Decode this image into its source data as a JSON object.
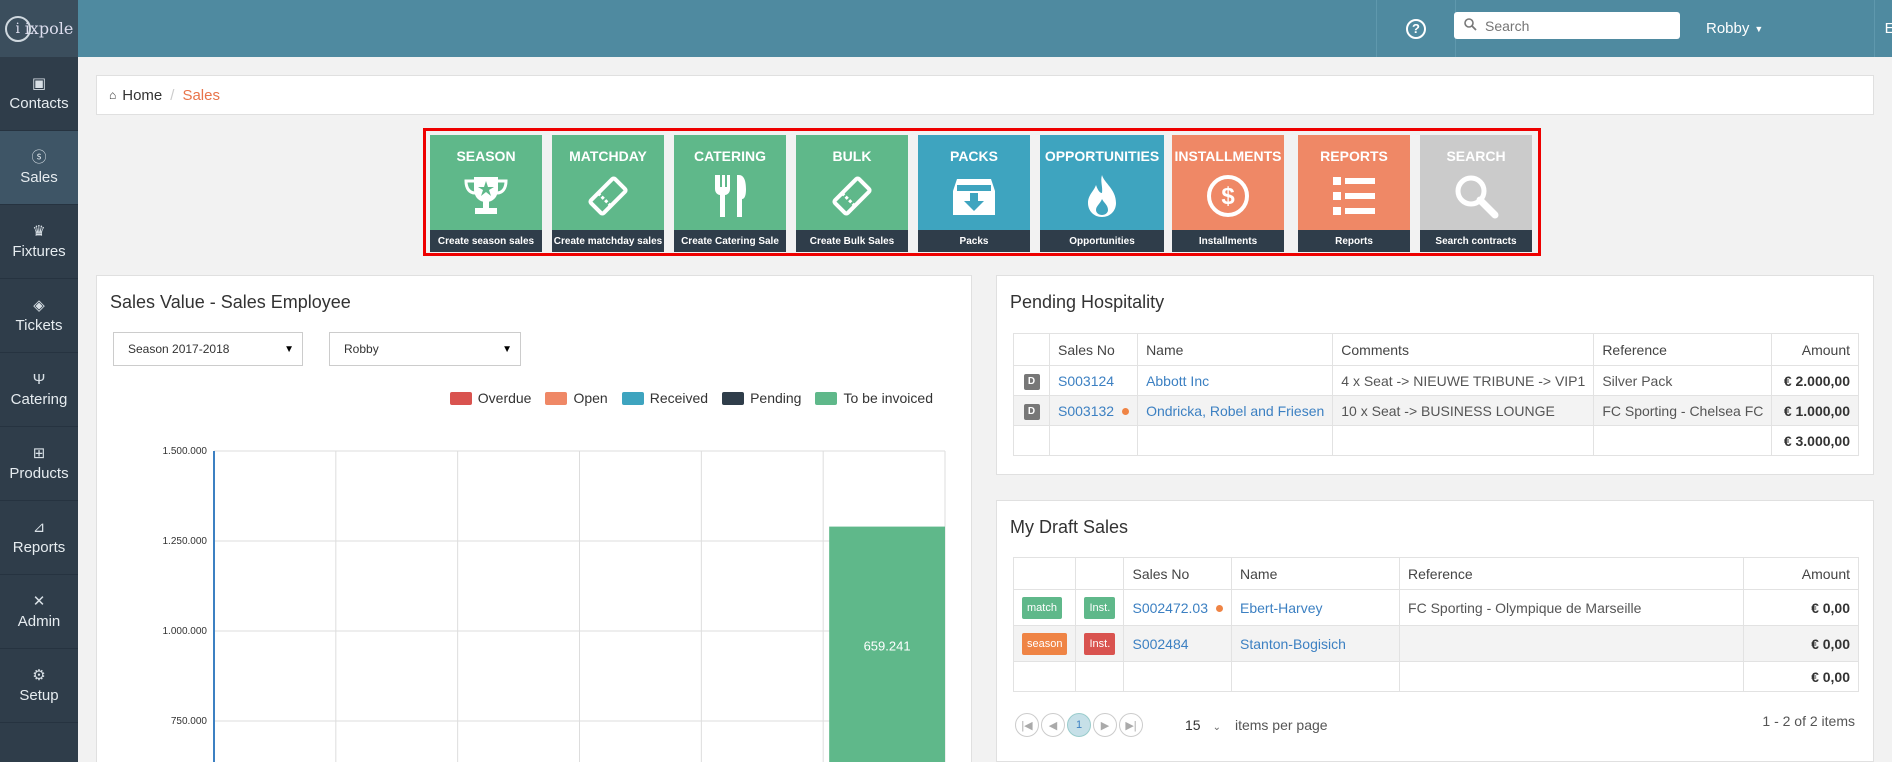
{
  "app": {
    "logo_text": "ixpole"
  },
  "sidebar": {
    "items": [
      {
        "label": "Contacts",
        "icon": "contacts-icon"
      },
      {
        "label": "Sales",
        "icon": "dollar-icon"
      },
      {
        "label": "Fixtures",
        "icon": "trophy-icon"
      },
      {
        "label": "Tickets",
        "icon": "ticket-icon"
      },
      {
        "label": "Catering",
        "icon": "cutlery-icon"
      },
      {
        "label": "Products",
        "icon": "cart-icon"
      },
      {
        "label": "Reports",
        "icon": "chart-icon"
      },
      {
        "label": "Admin",
        "icon": "tools-icon"
      },
      {
        "label": "Setup",
        "icon": "gears-icon"
      }
    ],
    "active": "Sales"
  },
  "topbar": {
    "help_glyph": "?",
    "search_placeholder": "Search",
    "user": "Robby",
    "language": "EN"
  },
  "breadcrumb": {
    "home": "Home",
    "separator": "/",
    "current": "Sales"
  },
  "tiles": [
    {
      "title": "SEASON",
      "caption": "Create season sales",
      "color": "#5fb88a",
      "icon": "trophy-icon"
    },
    {
      "title": "MATCHDAY",
      "caption": "Create matchday sales",
      "color": "#5fb88a",
      "icon": "ticket-icon"
    },
    {
      "title": "CATERING",
      "caption": "Create Catering Sale",
      "color": "#5fb88a",
      "icon": "cutlery-icon"
    },
    {
      "title": "BULK",
      "caption": "Create Bulk Sales",
      "color": "#5fb88a",
      "icon": "ticket-icon"
    },
    {
      "title": "PACKS",
      "caption": "Packs",
      "color": "#3ea4bf",
      "icon": "inbox-download-icon"
    },
    {
      "title": "OPPORTUNITIES",
      "caption": "Opportunities",
      "color": "#3ea4bf",
      "icon": "fire-icon"
    },
    {
      "title": "INSTALLMENTS",
      "caption": "Installments",
      "color": "#ef8866",
      "icon": "dollar-circle-icon"
    },
    {
      "title": "REPORTS",
      "caption": "Reports",
      "color": "#ef8866",
      "icon": "list-icon"
    },
    {
      "title": "SEARCH",
      "caption": "Search contracts",
      "color": "#cbcbcb",
      "icon": "search-icon"
    }
  ],
  "sales_panel": {
    "title": "Sales Value - Sales Employee",
    "season_select": "Season 2017-2018",
    "employee_select": "Robby",
    "legend": [
      {
        "label": "Overdue",
        "color": "#d9534f"
      },
      {
        "label": "Open",
        "color": "#ef8866"
      },
      {
        "label": "Received",
        "color": "#3ea4bf"
      },
      {
        "label": "Pending",
        "color": "#2f3d4a"
      },
      {
        "label": "To be invoiced",
        "color": "#5fb88a"
      }
    ]
  },
  "chart_data": {
    "type": "bar",
    "yticks": [
      "1.500.000",
      "1.250.000",
      "1.000.000",
      "750.000"
    ],
    "ylim_visible": [
      750000,
      1500000
    ],
    "series": [
      {
        "name": "To be invoiced",
        "values": [
          659241
        ],
        "labels": [
          "659.241"
        ]
      }
    ],
    "bar_top_value": 1290000,
    "grid": true,
    "legend_position": "top-right"
  },
  "pending_panel": {
    "title": "Pending Hospitality",
    "columns": [
      "Sales No",
      "Name",
      "Comments",
      "Reference",
      "Amount"
    ],
    "rows": [
      {
        "badge": "D",
        "sales_no": "S003124",
        "dot": false,
        "name": "Abbott Inc",
        "comments": "4 x Seat -> NIEUWE TRIBUNE -> VIP1",
        "reference": "Silver Pack",
        "amount": "€ 2.000,00"
      },
      {
        "badge": "D",
        "sales_no": "S003132",
        "dot": true,
        "name": "Ondricka, Robel and Friesen",
        "comments": "10 x Seat -> BUSINESS LOUNGE",
        "reference": "FC Sporting - Chelsea FC",
        "amount": "€ 1.000,00"
      }
    ],
    "total": "€ 3.000,00"
  },
  "draft_panel": {
    "title": "My Draft Sales",
    "columns": [
      "Sales No",
      "Name",
      "Reference",
      "Amount"
    ],
    "rows": [
      {
        "tag1": "match",
        "tag1_color": "#5fb88a",
        "tag2": "Inst.",
        "tag2_color": "#5fb88a",
        "sales_no": "S002472.03",
        "dot": true,
        "name": "Ebert-Harvey",
        "reference": "FC Sporting - Olympique de Marseille",
        "amount": "€ 0,00"
      },
      {
        "tag1": "season",
        "tag1_color": "#ef8445",
        "tag2": "Inst.",
        "tag2_color": "#d9534f",
        "sales_no": "S002484",
        "dot": false,
        "name": "Stanton-Bogisich",
        "reference": "",
        "amount": "€ 0,00"
      }
    ],
    "total": "€ 0,00",
    "pager": {
      "current_page": "1",
      "page_size": "15",
      "page_size_label": "items per page",
      "summary": "1 - 2 of 2 items"
    }
  }
}
